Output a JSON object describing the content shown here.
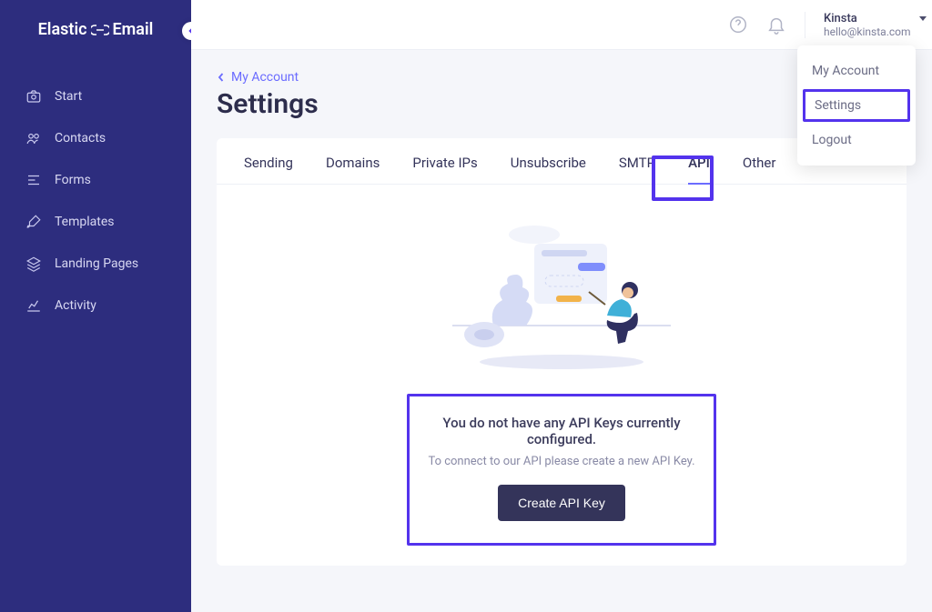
{
  "brand": {
    "left": "Elastic",
    "right": "Email"
  },
  "sidebar": {
    "items": [
      {
        "label": "Start"
      },
      {
        "label": "Contacts"
      },
      {
        "label": "Forms"
      },
      {
        "label": "Templates"
      },
      {
        "label": "Landing Pages"
      },
      {
        "label": "Activity"
      }
    ]
  },
  "account": {
    "name": "Kinsta",
    "email": "hello@kinsta.com",
    "menu": {
      "my_account": "My Account",
      "settings": "Settings",
      "logout": "Logout"
    }
  },
  "breadcrumb": {
    "label": "My Account"
  },
  "page_title": "Settings",
  "tabs": [
    {
      "label": "Sending"
    },
    {
      "label": "Domains"
    },
    {
      "label": "Private IPs"
    },
    {
      "label": "Unsubscribe"
    },
    {
      "label": "SMTP"
    },
    {
      "label": "API",
      "active": true
    },
    {
      "label": "Other"
    }
  ],
  "empty_state": {
    "title": "You do not have any API Keys currently configured.",
    "subtitle": "To connect to our API please create a new API Key.",
    "button": "Create API Key"
  }
}
